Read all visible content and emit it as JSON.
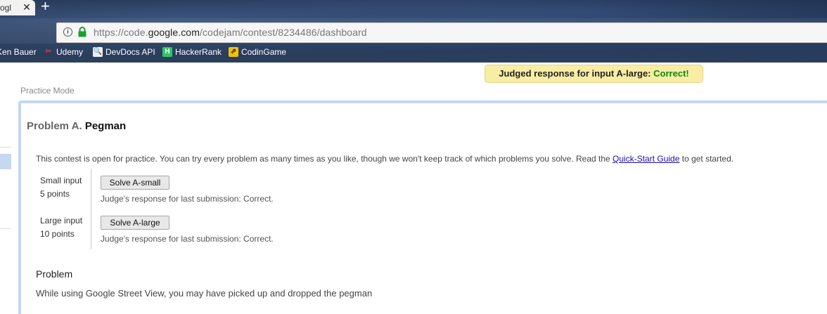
{
  "browser": {
    "tab_title": "ogl",
    "url_prefix": "https://code.",
    "url_host": "google.com",
    "url_path": "/codejam/contest/8234486/dashboard",
    "bookmarks": [
      "Ken Bauer",
      "Udemy",
      "DevDocs API",
      "HackerRank",
      "CodinGame"
    ]
  },
  "banner": {
    "prefix": "Judged response for input A-large: ",
    "result": "Correct!",
    "result_color": "#0a8a0a"
  },
  "page": {
    "mode": "Practice Mode",
    "problem_prefix": "Problem A.",
    "problem_name": "Pegman",
    "intro_text": "This contest is open for practice. You can try every problem as many times as you like, though we won't keep track of which problems you solve. Read the ",
    "intro_link": "Quick-Start Guide",
    "intro_suffix": " to get started.",
    "inputs": [
      {
        "name": "Small input",
        "points": "5 points",
        "button": "Solve A-small",
        "response": "Judge's response for last submission: Correct."
      },
      {
        "name": "Large input",
        "points": "10 points",
        "button": "Solve A-large",
        "response": "Judge's response for last submission: Correct."
      }
    ],
    "section_heading": "Problem",
    "statement_start": "While using Google Street View, you may have picked up and dropped the pegman"
  }
}
